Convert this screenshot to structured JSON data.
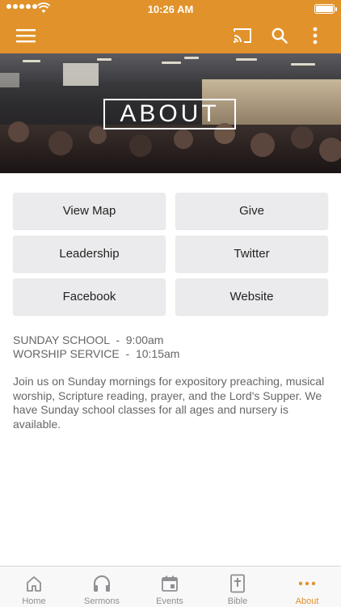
{
  "status_bar": {
    "time": "10:26 AM"
  },
  "app_bar": {
    "menu_icon": "hamburger-menu-icon",
    "cast_icon": "cast-icon",
    "search_icon": "search-icon",
    "more_icon": "more-vertical-icon"
  },
  "hero": {
    "title": "ABOUT"
  },
  "buttons": [
    {
      "label": "View Map"
    },
    {
      "label": "Give"
    },
    {
      "label": "Leadership"
    },
    {
      "label": "Twitter"
    },
    {
      "label": "Facebook"
    },
    {
      "label": "Website"
    }
  ],
  "schedule": [
    "SUNDAY SCHOOL  -  9:00am",
    "WORSHIP SERVICE  -  10:15am"
  ],
  "description": "Join us on Sunday mornings for expository preaching, musical worship, Scripture reading, prayer, and the Lord's Supper. We have Sunday school classes for all ages and nursery is available.",
  "tabs": [
    {
      "label": "Home",
      "icon": "home-icon"
    },
    {
      "label": "Sermons",
      "icon": "headphones-icon"
    },
    {
      "label": "Events",
      "icon": "calendar-icon"
    },
    {
      "label": "Bible",
      "icon": "bible-icon"
    },
    {
      "label": "About",
      "icon": "more-horizontal-icon",
      "active": true
    }
  ],
  "colors": {
    "accent": "#e1922a",
    "button_bg": "#ebebed",
    "tab_inactive": "#8e8e93"
  }
}
